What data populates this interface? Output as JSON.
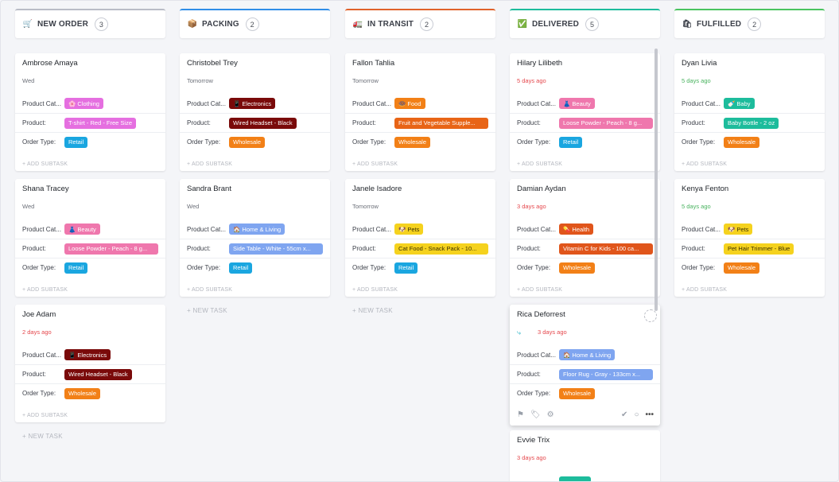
{
  "columns": [
    {
      "title": "NEW ORDER",
      "count": "3",
      "icon": "shopping-cart-icon",
      "glyph": "🛒",
      "accent": "#b9bcc6",
      "cards": [
        {
          "name": "Ambrose Amaya",
          "date": "Wed",
          "date_color": "gray",
          "category_label": "Product Cat...",
          "category": "🌸 Clothing",
          "category_color": "#e56fe0",
          "product_label": "Product:",
          "product": "T-shirt - Red - Free Size",
          "product_color": "#e56fe0",
          "order_label": "Order Type:",
          "order": "Retail",
          "order_color": "#1aa6e0",
          "add_subtask": "+ ADD SUBTASK"
        },
        {
          "name": "Shana Tracey",
          "date": "Wed",
          "date_color": "gray",
          "category_label": "Product Cat...",
          "category": "👗 Beauty",
          "category_color": "#ef77ad",
          "product_label": "Product:",
          "product": "Loose Powder - Peach - 8 g...",
          "product_color": "#ef77ad",
          "order_label": "Order Type:",
          "order": "Retail",
          "order_color": "#1aa6e0",
          "add_subtask": "+ ADD SUBTASK"
        },
        {
          "name": "Joe Adam",
          "date": "2 days ago",
          "date_color": "red",
          "category_label": "Product Cat...",
          "category": "📱 Electronics",
          "category_color": "#7a0a0a",
          "product_label": "Product:",
          "product": "Wired Headset - Black",
          "product_color": "#7a0a0a",
          "order_label": "Order Type:",
          "order": "Wholesale",
          "order_color": "#f28017",
          "add_subtask": "+ ADD SUBTASK"
        }
      ],
      "new_task": "+ NEW TASK"
    },
    {
      "title": "PACKING",
      "count": "2",
      "icon": "package-icon",
      "glyph": "📦",
      "accent": "#2f8ee8",
      "cards": [
        {
          "name": "Christobel Trey",
          "date": "Tomorrow",
          "date_color": "gray",
          "category_label": "Product Cat...",
          "category": "📱 Electronics",
          "category_color": "#7a0a0a",
          "product_label": "Product:",
          "product": "Wired Headset - Black",
          "product_color": "#7a0a0a",
          "order_label": "Order Type:",
          "order": "Wholesale",
          "order_color": "#f28017",
          "add_subtask": "+ ADD SUBTASK"
        },
        {
          "name": "Sandra Brant",
          "date": "Wed",
          "date_color": "gray",
          "category_label": "Product Cat...",
          "category": "🏠 Home & Living",
          "category_color": "#7fa5f0",
          "product_label": "Product:",
          "product": "Side Table - White - 55cm x...",
          "product_color": "#7fa5f0",
          "order_label": "Order Type:",
          "order": "Retail",
          "order_color": "#1aa6e0",
          "add_subtask": "+ ADD SUBTASK"
        }
      ],
      "new_task": "+ NEW TASK"
    },
    {
      "title": "IN TRANSIT",
      "count": "2",
      "icon": "truck-icon",
      "glyph": "🚛",
      "accent": "#e0622a",
      "cards": [
        {
          "name": "Fallon Tahlia",
          "date": "Tomorrow",
          "date_color": "gray",
          "category_label": "Product Cat...",
          "category": "🍩 Food",
          "category_color": "#f28017",
          "product_label": "Product:",
          "product": "Fruit and Vegetable Supple...",
          "product_color": "#e86416",
          "order_label": "Order Type:",
          "order": "Wholesale",
          "order_color": "#f28017",
          "add_subtask": "+ ADD SUBTASK"
        },
        {
          "name": "Janele Isadore",
          "date": "Tomorrow",
          "date_color": "gray",
          "category_label": "Product Cat...",
          "category": "🐶 Pets",
          "category_color": "#f5d21e",
          "product_label": "Product:",
          "product": "Cat Food - Snack Pack - 10...",
          "product_color": "#f5d21e",
          "order_label": "Order Type:",
          "order": "Retail",
          "order_color": "#1aa6e0",
          "add_subtask": "+ ADD SUBTASK"
        }
      ],
      "new_task": "+ NEW TASK"
    },
    {
      "title": "DELIVERED",
      "count": "5",
      "icon": "check-box-icon",
      "glyph": "✅",
      "accent": "#1dbc9c",
      "cards": [
        {
          "name": "Hilary Lilibeth",
          "date": "5 days ago",
          "date_color": "red",
          "category_label": "Product Cat...",
          "category": "👗 Beauty",
          "category_color": "#ef77ad",
          "product_label": "Product:",
          "product": "Loose Powder - Peach - 8 g...",
          "product_color": "#ef77ad",
          "order_label": "Order Type:",
          "order": "Retail",
          "order_color": "#1aa6e0",
          "add_subtask": "+ ADD SUBTASK"
        },
        {
          "name": "Damian Aydan",
          "date": "3 days ago",
          "date_color": "red",
          "category_label": "Product Cat...",
          "category": "💊 Health",
          "category_color": "#e0551b",
          "product_label": "Product:",
          "product": "Vitamin C for Kids - 100 ca...",
          "product_color": "#e0551b",
          "order_label": "Order Type:",
          "order": "Wholesale",
          "order_color": "#f28017",
          "add_subtask": "+ ADD SUBTASK"
        },
        {
          "name": "Rica Deforrest",
          "date": "3 days ago",
          "date_color": "red",
          "category_label": "Product Cat...",
          "category": "🏠 Home & Living",
          "category_color": "#7fa5f0",
          "product_label": "Product:",
          "product": "Floor Rug - Gray - 133cm x...",
          "product_color": "#7fa5f0",
          "order_label": "Order Type:",
          "order": "Wholesale",
          "order_color": "#f28017"
        },
        {
          "name": "Evvie Trix",
          "date": "3 days ago",
          "date_color": "red",
          "category_color": "#1dbc9c"
        }
      ]
    },
    {
      "title": "FULFILLED",
      "count": "2",
      "icon": "shopping-bag-icon",
      "glyph": "🛍",
      "accent": "#49c35f",
      "cards": [
        {
          "name": "Dyan Livia",
          "date": "5 days ago",
          "date_color": "green",
          "category_label": "Product Cat...",
          "category": "🍼 Baby",
          "category_color": "#1dbc9c",
          "product_label": "Product:",
          "product": "Baby Bottle - 2 oz",
          "product_color": "#1dbc9c",
          "order_label": "Order Type:",
          "order": "Wholesale",
          "order_color": "#f28017",
          "add_subtask": "+ ADD SUBTASK"
        },
        {
          "name": "Kenya Fenton",
          "date": "5 days ago",
          "date_color": "green",
          "category_label": "Product Cat...",
          "category": "🐶 Pets",
          "category_color": "#f5d21e",
          "product_label": "Product:",
          "product": "Pet Hair Trimmer - Blue",
          "product_color": "#f5d21e",
          "order_label": "Order Type:",
          "order": "Wholesale",
          "order_color": "#f28017",
          "add_subtask": "+ ADD SUBTASK"
        }
      ]
    }
  ]
}
